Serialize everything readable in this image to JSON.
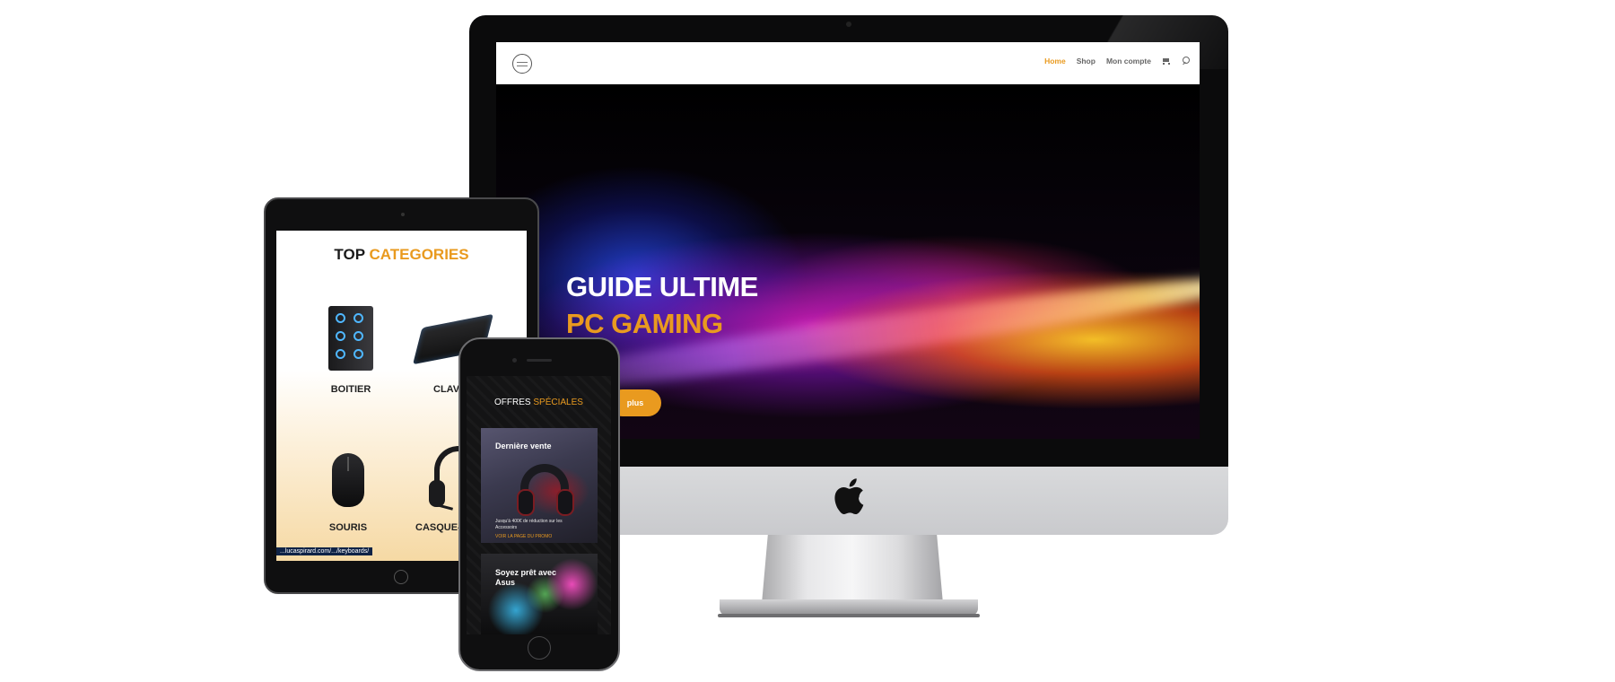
{
  "desktop": {
    "nav": {
      "home": "Home",
      "shop": "Shop",
      "account": "Mon compte"
    },
    "hero": {
      "title_line1": "GUIDE ULTIME",
      "title_line2": "PC GAMING",
      "button_label": "plus"
    }
  },
  "tablet": {
    "heading_plain": "TOP",
    "heading_accent": "CATEGORIES",
    "categories": [
      "BOITIER",
      "CLAV",
      "SOURIS",
      "CASQUE-"
    ],
    "status_url": "...lucaspirard.com/.../keyboards/"
  },
  "phone": {
    "heading_plain": "OFFRES",
    "heading_accent": "SPÉCIALES",
    "promo1": {
      "title": "Dernière vente",
      "subtitle": "Jusqu'à 400€ de réduction sur les Accessoirs",
      "link": "VOIR LA PAGE DU PROMO"
    },
    "promo2": {
      "title": "Soyez prêt avec Asus"
    }
  },
  "colors": {
    "accent": "#e99a1f",
    "device_black": "#0b0b0c",
    "imac_silver": "#d9dadc"
  },
  "icons": [
    "cart-icon",
    "search-icon",
    "apple-logo-icon"
  ]
}
